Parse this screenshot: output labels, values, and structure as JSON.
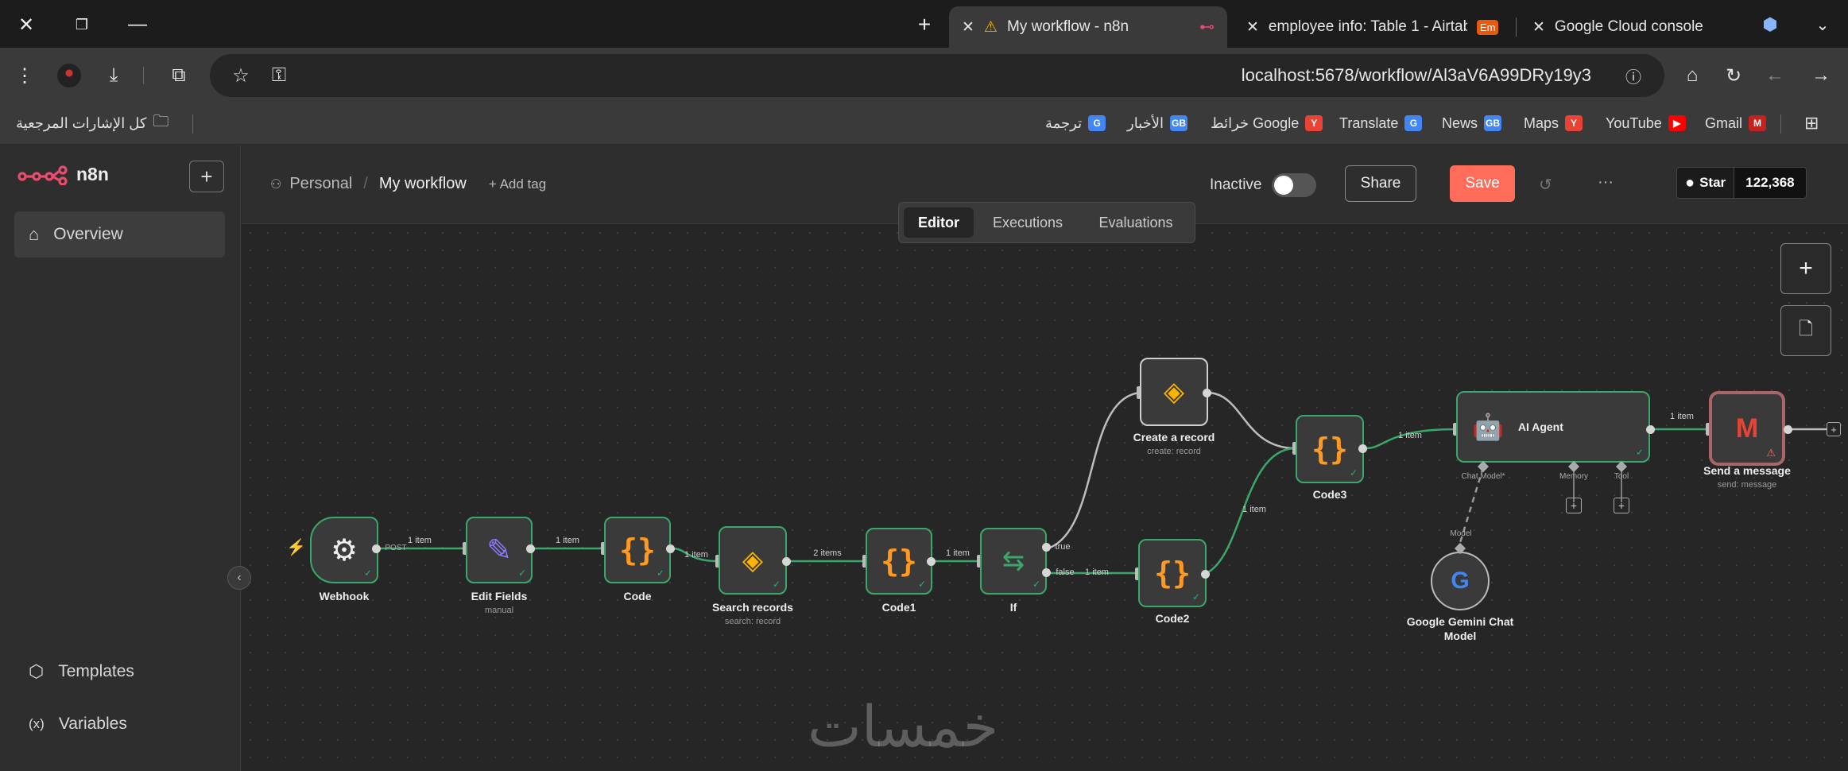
{
  "browser": {
    "tabs": [
      {
        "title": "My workflow - n8n",
        "active": true
      },
      {
        "title": "employee info: Table 1 - Airtabl",
        "badge": "Em"
      },
      {
        "title": "Google Cloud console"
      }
    ],
    "url": "localhost:5678/workflow/Al3aV6A99DRy19y3",
    "bookmarks": [
      {
        "label": "Gmail",
        "color": "#c5221f"
      },
      {
        "label": "YouTube",
        "color": "#ff0000"
      },
      {
        "label": "Maps",
        "color": "#ea4335"
      },
      {
        "label": "News",
        "color": "#4285f4"
      },
      {
        "label": "Translate",
        "color": "#4285f4"
      },
      {
        "label": "خرائط Google",
        "color": "#ea4335"
      },
      {
        "label": "الأخبار",
        "color": "#4285f4"
      },
      {
        "label": "ترجمة",
        "color": "#4285f4"
      }
    ],
    "all_bookmarks": "كل الإشارات المرجعية"
  },
  "sidebar": {
    "logo": "n8n",
    "items": [
      {
        "label": "Overview",
        "icon": "home-icon"
      },
      {
        "label": "Templates",
        "icon": "box-icon"
      },
      {
        "label": "Variables",
        "icon": "variables-icon"
      }
    ]
  },
  "header": {
    "breadcrumb_owner": "Personal",
    "breadcrumb_sep": "/",
    "workflow_name": "My workflow",
    "add_tag": "+ Add tag",
    "status": "Inactive",
    "share": "Share",
    "save": "Save",
    "more": "···",
    "github_star": "Star",
    "github_count": "122,368",
    "tabs": [
      "Editor",
      "Executions",
      "Evaluations"
    ],
    "active_tab": "Editor"
  },
  "canvas": {
    "nodes": [
      {
        "id": "webhook",
        "name": "Webhook",
        "sub": ""
      },
      {
        "id": "edit_fields",
        "name": "Edit Fields",
        "sub": "manual"
      },
      {
        "id": "code",
        "name": "Code",
        "sub": ""
      },
      {
        "id": "search_records",
        "name": "Search records",
        "sub": "search: record"
      },
      {
        "id": "code1",
        "name": "Code1",
        "sub": ""
      },
      {
        "id": "if",
        "name": "If",
        "sub": ""
      },
      {
        "id": "create_record",
        "name": "Create a record",
        "sub": "create: record"
      },
      {
        "id": "code2",
        "name": "Code2",
        "sub": ""
      },
      {
        "id": "code3",
        "name": "Code3",
        "sub": ""
      },
      {
        "id": "ai_agent",
        "name": "AI Agent",
        "sub": ""
      },
      {
        "id": "send_message",
        "name": "Send a message",
        "sub": "send: message"
      },
      {
        "id": "gemini",
        "name": "Google Gemini Chat",
        "name2": "Model",
        "sub": ""
      }
    ],
    "edge_labels": {
      "webhook_post": "POST",
      "e1": "1 item",
      "e2": "1 item",
      "e3": "1 item",
      "e4": "2 items",
      "e5": "1 item",
      "if_true": "true",
      "if_false": "false",
      "e6": "1 item",
      "e7": "1 item",
      "e8": "1 item",
      "e9": "1 item"
    },
    "agent_ports": {
      "chat_model": "Chat Model*",
      "memory": "Memory",
      "tool": "Tool",
      "model": "Model"
    },
    "watermark": "خمسات"
  }
}
